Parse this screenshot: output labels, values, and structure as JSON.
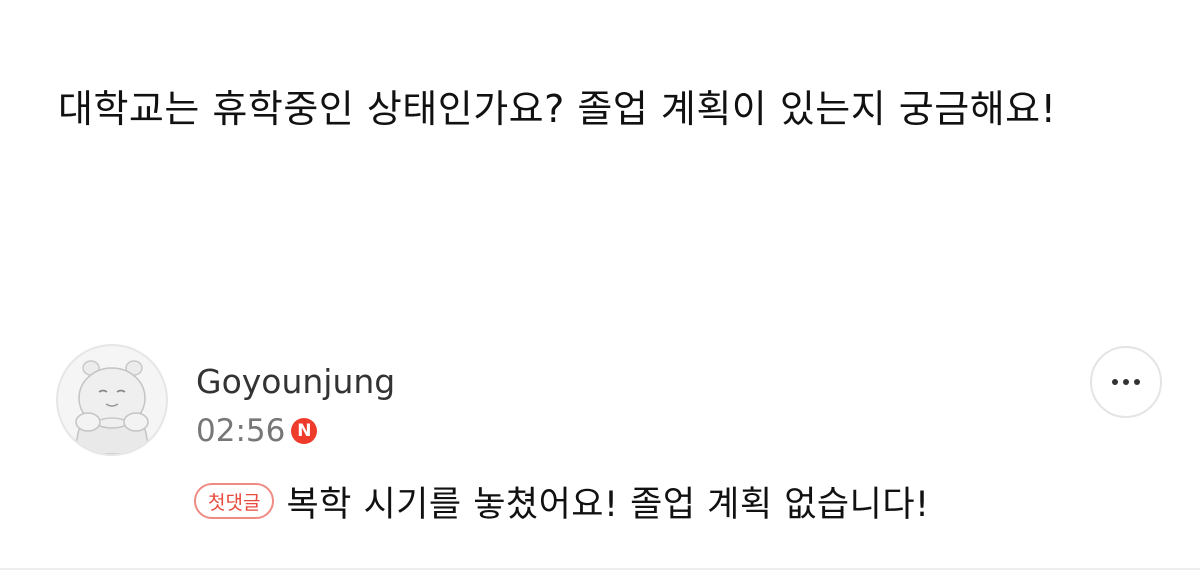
{
  "question": {
    "text": "대학교는 휴학중인 상태인가요? 졸업 계획이 있는지 궁금해요!"
  },
  "comment": {
    "avatar_icon": "hippo-character-avatar-icon",
    "username": "Goyounjung",
    "timestamp": "02:56",
    "new_badge": "N",
    "more_icon": "more-horizontal-icon",
    "first_comment_badge": "첫댓글",
    "reply_text": "복학 시기를 놓쳤어요! 졸업 계획 없습니다!"
  },
  "colors": {
    "new_badge": "#ef3b2c",
    "first_comment_badge": "#e84a3c",
    "text": "#111111",
    "muted": "#777777"
  }
}
